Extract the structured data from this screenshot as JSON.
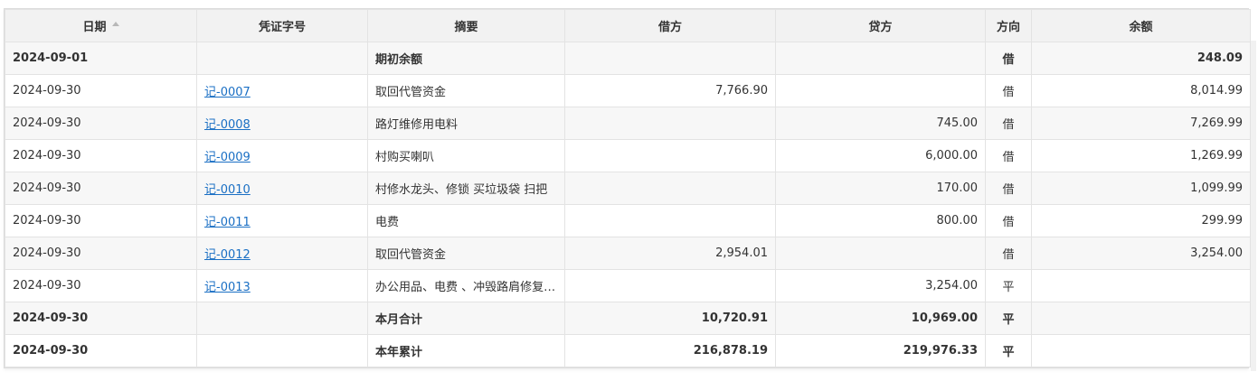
{
  "columns": {
    "date": "日期",
    "voucher": "凭证字号",
    "summary": "摘要",
    "debit": "借方",
    "credit": "贷方",
    "direction": "方向",
    "balance": "余额"
  },
  "rows": [
    {
      "date": "2024-09-01",
      "voucher": "",
      "summary": "期初余额",
      "debit": "",
      "credit": "",
      "direction": "借",
      "balance": "248.09",
      "bold": true
    },
    {
      "date": "2024-09-30",
      "voucher": "记-0007",
      "summary": "取回代管资金",
      "debit": "7,766.90",
      "credit": "",
      "direction": "借",
      "balance": "8,014.99",
      "bold": false
    },
    {
      "date": "2024-09-30",
      "voucher": "记-0008",
      "summary": "路灯维修用电料",
      "debit": "",
      "credit": "745.00",
      "direction": "借",
      "balance": "7,269.99",
      "bold": false
    },
    {
      "date": "2024-09-30",
      "voucher": "记-0009",
      "summary": "村购买喇叭",
      "debit": "",
      "credit": "6,000.00",
      "direction": "借",
      "balance": "1,269.99",
      "bold": false
    },
    {
      "date": "2024-09-30",
      "voucher": "记-0010",
      "summary": "村修水龙头、修锁 买垃圾袋 扫把",
      "debit": "",
      "credit": "170.00",
      "direction": "借",
      "balance": "1,099.99",
      "bold": false
    },
    {
      "date": "2024-09-30",
      "voucher": "记-0011",
      "summary": "电费",
      "debit": "",
      "credit": "800.00",
      "direction": "借",
      "balance": "299.99",
      "bold": false
    },
    {
      "date": "2024-09-30",
      "voucher": "记-0012",
      "summary": "取回代管资金",
      "debit": "2,954.01",
      "credit": "",
      "direction": "借",
      "balance": "3,254.00",
      "bold": false
    },
    {
      "date": "2024-09-30",
      "voucher": "记-0013",
      "summary": "办公用品、电费 、冲毁路肩修复 ...",
      "debit": "",
      "credit": "3,254.00",
      "direction": "平",
      "balance": "",
      "bold": false
    },
    {
      "date": "2024-09-30",
      "voucher": "",
      "summary": "本月合计",
      "debit": "10,720.91",
      "credit": "10,969.00",
      "direction": "平",
      "balance": "",
      "bold": true
    },
    {
      "date": "2024-09-30",
      "voucher": "",
      "summary": "本年累计",
      "debit": "216,878.19",
      "credit": "219,976.33",
      "direction": "平",
      "balance": "",
      "bold": true
    }
  ],
  "colors": {
    "link": "#1a6fc4",
    "header_bg": "#f2f2f2",
    "row_alt_bg": "#f7f7f7"
  },
  "icons": {
    "date_sort": "sort-ascending-icon"
  }
}
